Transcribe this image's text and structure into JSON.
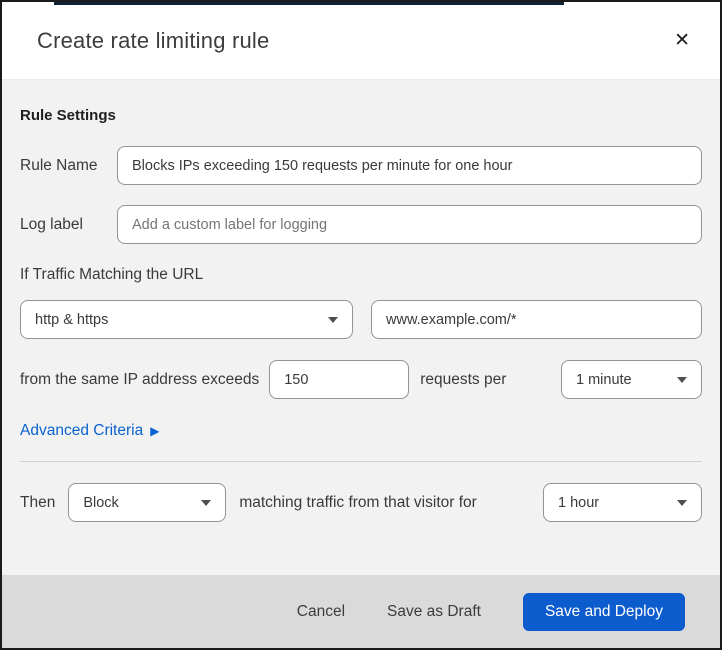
{
  "modal": {
    "title": "Create rate limiting rule",
    "close_icon": "✕"
  },
  "form": {
    "section_heading": "Rule Settings",
    "rule_name": {
      "label": "Rule Name",
      "value": "Blocks IPs exceeding 150 requests per minute for one hour"
    },
    "log_label": {
      "label": "Log label",
      "placeholder": "Add a custom label for logging"
    },
    "traffic_match": {
      "heading": "If Traffic Matching the URL",
      "protocol_value": "http & https",
      "url_value": "www.example.com/*"
    },
    "threshold": {
      "prefix": "from the same IP address exceeds",
      "requests_value": "150",
      "middle": "requests per",
      "period_value": "1 minute"
    },
    "advanced_criteria": {
      "label": "Advanced Criteria",
      "arrow_icon": "▶"
    },
    "action": {
      "prefix": "Then",
      "action_value": "Block",
      "middle": "matching traffic from that visitor for",
      "duration_value": "1 hour"
    }
  },
  "footer": {
    "cancel_label": "Cancel",
    "save_draft_label": "Save as Draft",
    "save_deploy_label": "Save and Deploy"
  },
  "colors": {
    "primary_button": "#0d5ccd",
    "link": "#0c63cf",
    "footer_bg": "#dadada",
    "body_bg": "#f2f2f2",
    "top_strip": "#0d2335"
  }
}
